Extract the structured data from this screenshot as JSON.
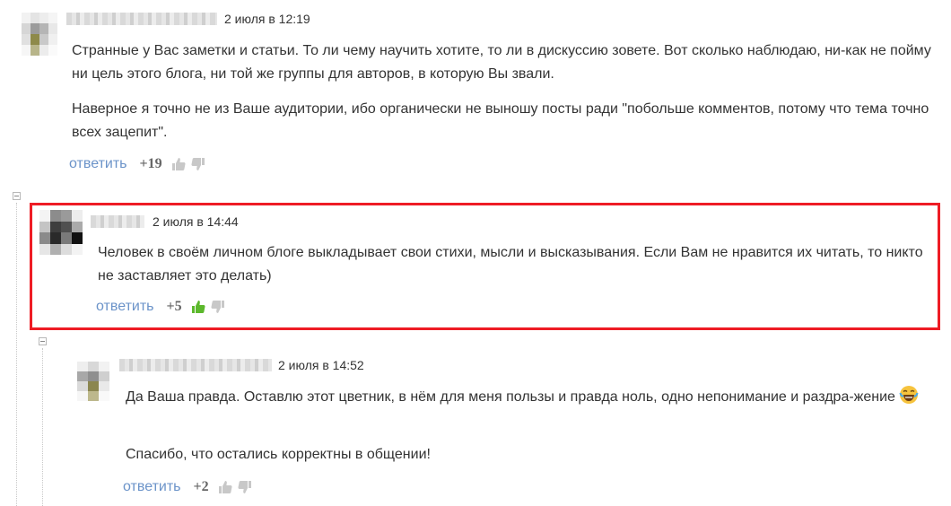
{
  "comments": [
    {
      "date": "2 июля в 12:19",
      "paragraphs": [
        "Странные у Вас заметки и статьи. То ли чему научить хотите, то ли в дискуссию зовете. Вот сколько наблюдаю, ни-как не пойму ни цель этого блога, ни той же группы для авторов, в которую Вы звали.",
        "Наверное я точно не из Ваше аудитории, ибо органически не выношу посты ради \"побольше комментов, потому что тема точно всех зацепит\"."
      ],
      "reply_label": "ответить",
      "score": "+19",
      "liked": false
    },
    {
      "date": "2 июля в 14:44",
      "paragraphs": [
        "Человек в своём личном блоге выкладывает свои стихи, мысли и высказывания. Если Вам не нравится их читать, то никто не заставляет это делать)"
      ],
      "reply_label": "ответить",
      "score": "+5",
      "liked": true,
      "highlighted": true
    },
    {
      "date": "2 июля в 14:52",
      "paragraphs": [
        "Да Ваша правда. Оставлю этот цветник, в нём для меня пользы и правда ноль, одно непонимание и раздра-жение",
        "Спасибо, что остались корректны в общении!"
      ],
      "emoji": "crying-laughing-emoji",
      "reply_label": "ответить",
      "score": "+2",
      "liked": false
    }
  ],
  "colors": {
    "highlight_border": "#ee1c25",
    "reply_link": "#6b93c9",
    "thumb_inactive": "#c8c8c8",
    "thumb_liked": "#5cb82c"
  },
  "icons": [
    "thumbs-up-icon",
    "thumbs-down-icon",
    "collapse-icon"
  ]
}
